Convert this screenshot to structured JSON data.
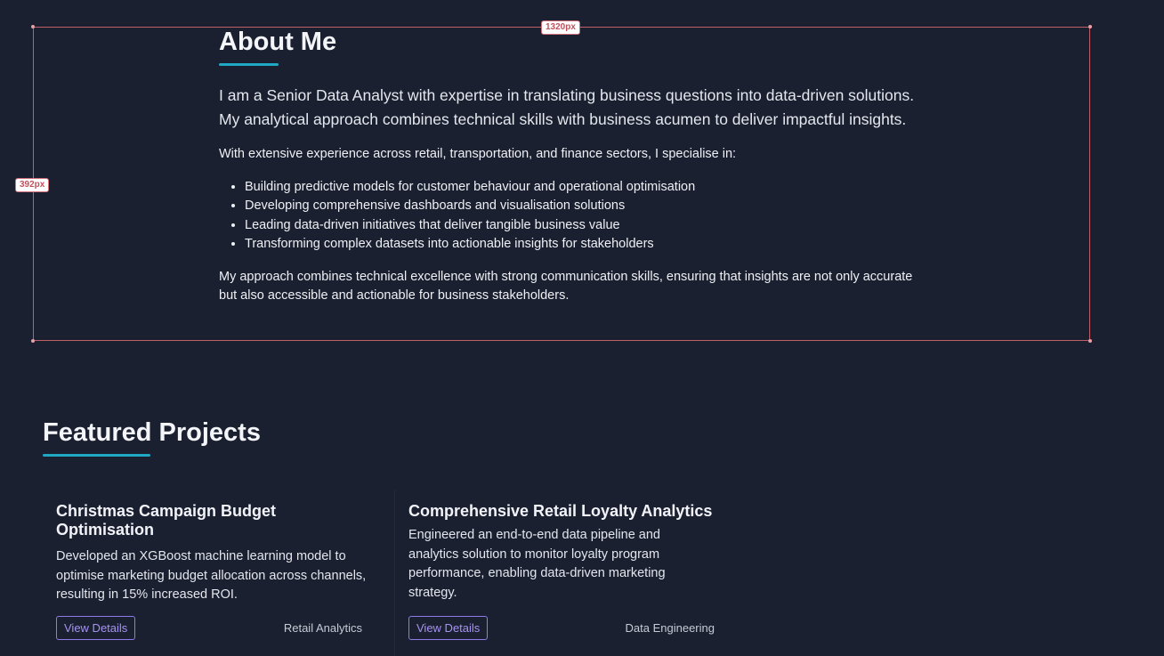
{
  "overlay": {
    "width_badge": "1320px",
    "height_badge": "392px"
  },
  "about": {
    "title": "About Me",
    "intro": "I am a Senior Data Analyst with expertise in translating business questions into data-driven solutions. My analytical approach combines technical skills with business acumen to deliver impactful insights.",
    "experience": "With extensive experience across retail, transportation, and finance sectors, I specialise in:",
    "specialisms": [
      "Building predictive models for customer behaviour and operational optimisation",
      "Developing comprehensive dashboards and visualisation solutions",
      "Leading data-driven initiatives that deliver tangible business value",
      "Transforming complex datasets into actionable insights for stakeholders"
    ],
    "approach": "My approach combines technical excellence with strong communication skills, ensuring that insights are not only accurate but also accessible and actionable for business stakeholders."
  },
  "projects": {
    "title": "Featured Projects",
    "items": [
      {
        "title": "Christmas Campaign Budget Optimisation",
        "description": "Developed an XGBoost machine learning model to optimise marketing budget allocation across channels, resulting in 15% increased ROI.",
        "button": "View Details",
        "tag": "Retail Analytics"
      },
      {
        "title": "Comprehensive Retail Loyalty Analytics",
        "description": "Engineered an end-to-end data pipeline and analytics solution to monitor loyalty program performance, enabling data-driven marketing strategy.",
        "button": "View Details",
        "tag": "Data Engineering"
      }
    ]
  },
  "colors": {
    "background": "#1b2030",
    "accent": "#1fa7c4",
    "button": "#8f7be6",
    "overlay": "#c15f69"
  }
}
